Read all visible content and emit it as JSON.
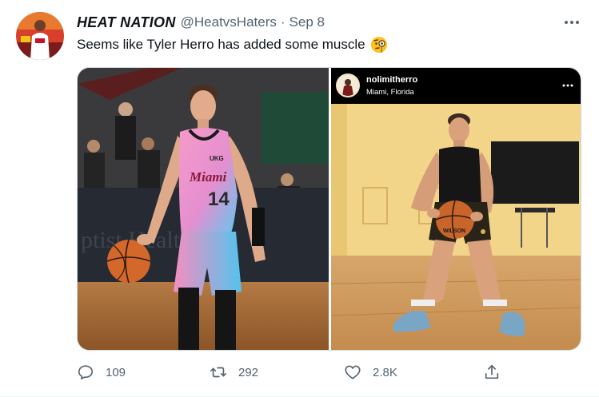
{
  "tweet": {
    "author": {
      "display_name": "HEAT NATION",
      "handle": "@HeatvsHaters"
    },
    "separator": "·",
    "date": "Sep 8",
    "text": "Seems like Tyler Herro has added some muscle",
    "emoji": "face-with-monocle"
  },
  "media": {
    "left_photo": {
      "jersey_script": "Miami",
      "jersey_number": "14",
      "shoulder_tag": "UKG",
      "bg_sign": "ptist Health"
    },
    "right_photo": {
      "ig_username": "nolimitherro",
      "ig_location": "Miami, Florida",
      "ball_text": "WILSON"
    }
  },
  "actions": {
    "replies": "109",
    "retweets": "292",
    "likes": "2.8K"
  },
  "colors": {
    "text_primary": "#0f1419",
    "text_secondary": "#536471",
    "border": "#cfd9de"
  }
}
